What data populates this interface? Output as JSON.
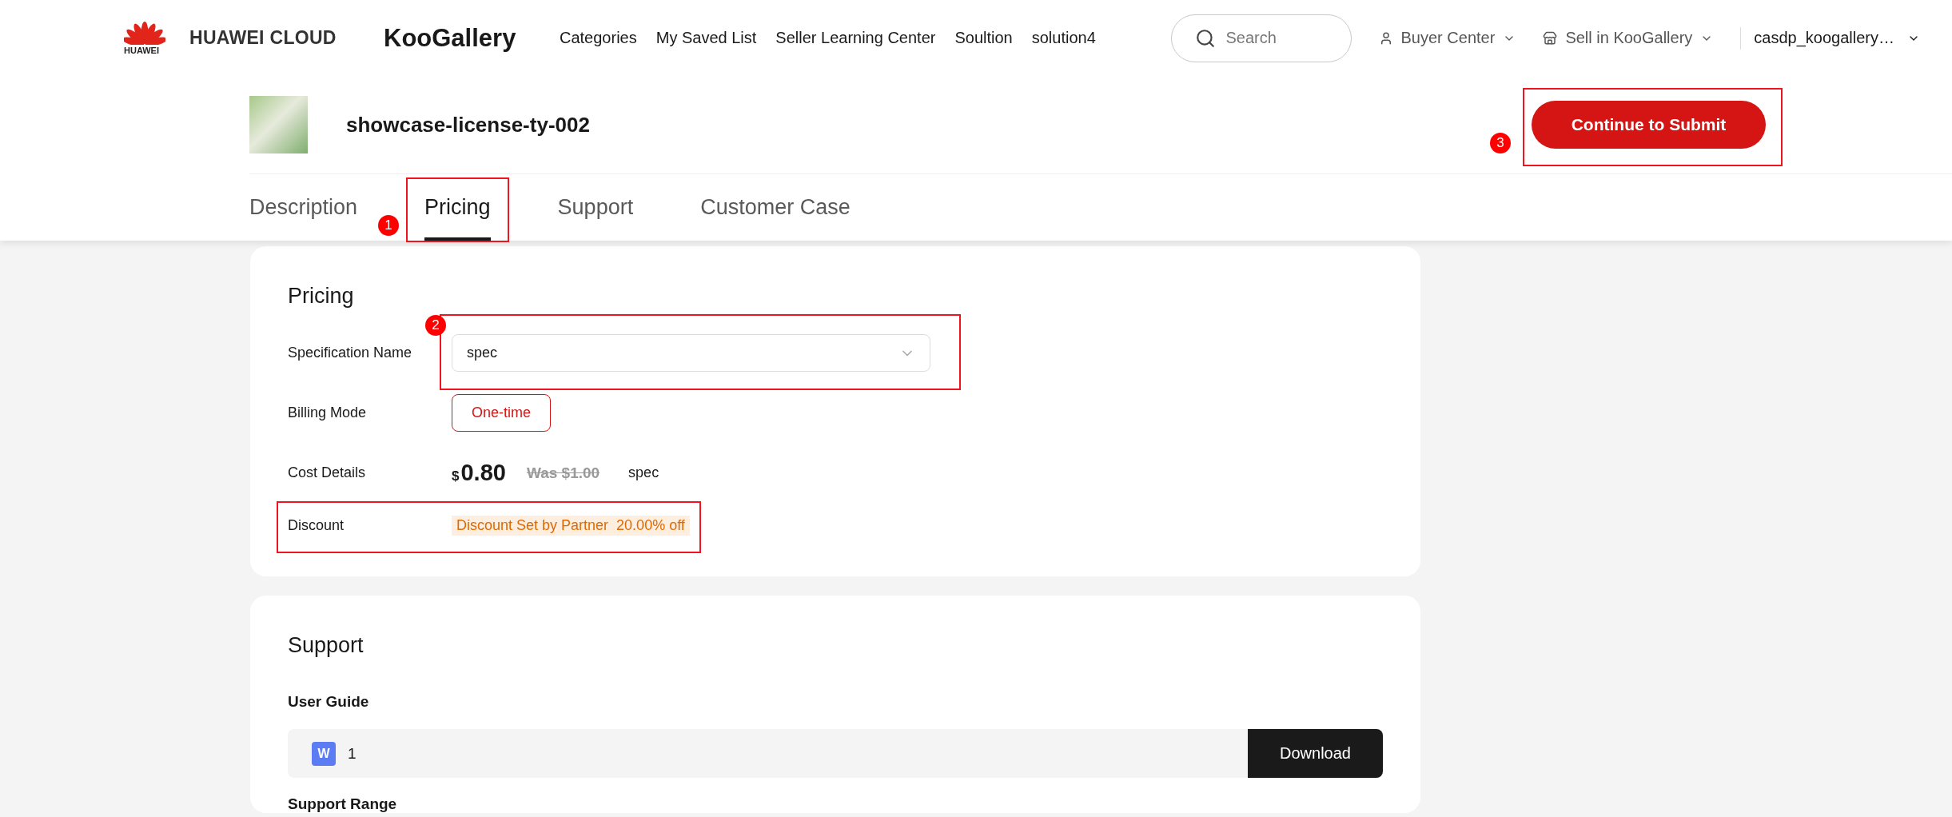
{
  "header": {
    "logo_wordmark": "HUAWEI",
    "brand": "HUAWEI CLOUD",
    "site": "KooGallery",
    "nav": [
      "Categories",
      "My Saved List",
      "Seller Learning Center",
      "Soultion",
      "solution4"
    ],
    "search": {
      "placeholder": "Search"
    },
    "menus": [
      {
        "label": "Buyer Center",
        "kind": "user"
      },
      {
        "label": "Sell in KooGallery",
        "kind": "store"
      }
    ],
    "account": "casdp_koogallery…"
  },
  "product": {
    "title": "showcase-license-ty-002",
    "submit": {
      "label": "Continue to Submit",
      "callout": "3"
    }
  },
  "tabs": [
    {
      "label": "Description",
      "selected": false
    },
    {
      "label": "Pricing",
      "selected": true,
      "callout": "1"
    },
    {
      "label": "Support",
      "selected": false
    },
    {
      "label": "Customer Case",
      "selected": false
    }
  ],
  "pricing": {
    "title": "Pricing",
    "rows": [
      {
        "kind": "select",
        "label": "Specification Name",
        "value": "spec",
        "callout": "2"
      },
      {
        "kind": "options",
        "label": "Billing Mode",
        "options": [
          {
            "label": "One-time",
            "selected": true
          }
        ]
      },
      {
        "kind": "cost",
        "label": "Cost Details",
        "currency": "$",
        "price": "0.80",
        "was": "Was $1.00",
        "unit": "spec"
      },
      {
        "kind": "tag",
        "label": "Discount",
        "tag": "Discount Set by Partner  20.00% off",
        "highlighted": true
      }
    ]
  },
  "support": {
    "title": "Support",
    "user_guide": {
      "heading": "User Guide",
      "files": [
        {
          "badge": "W",
          "name": "1",
          "action": "Download"
        }
      ]
    },
    "next_heading": "Support Range"
  }
}
